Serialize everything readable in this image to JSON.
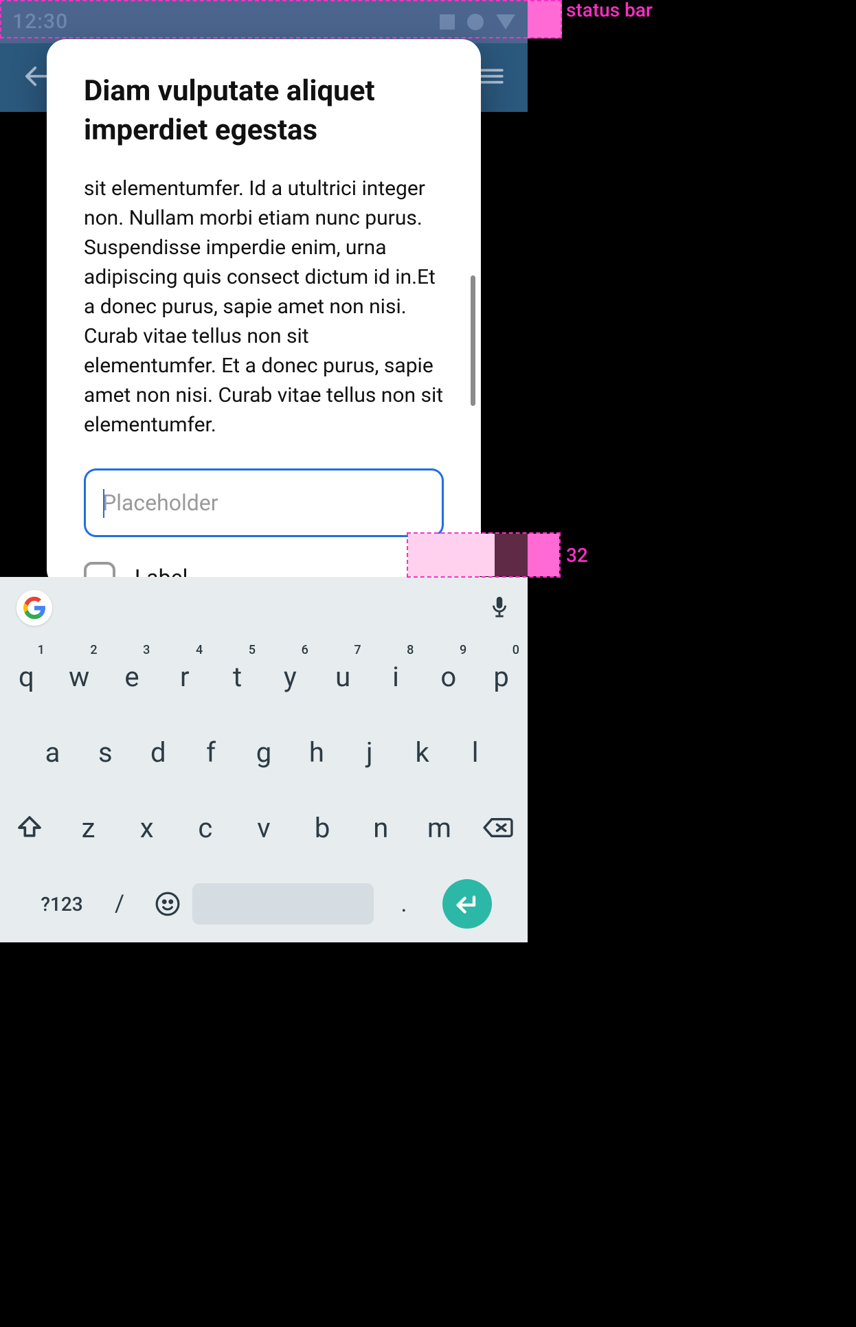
{
  "status": {
    "time": "12:30",
    "label": "status bar"
  },
  "dialog": {
    "title": "Diam vulputate aliquet imperdiet egestas",
    "body": "sit elementumfer. Id a utultrici integer non. Nullam morbi etiam nunc purus. Suspendisse imperdie enim, urna adipiscing quis consect dictum id in.Et a donec purus, sapie amet non nisi. Curab vitae tellus non sit elementumfer. Et a donec purus, sapie amet non nisi. Curab vitae tellus non sit elementumfer.",
    "placeholder": "Placeholder",
    "checkbox_label": "Label"
  },
  "redlines": {
    "keyboard_offset": "32"
  },
  "keyboard": {
    "mode": "?123",
    "slash": "/",
    "dot": ".",
    "row1": [
      {
        "main": "q",
        "sup": "1"
      },
      {
        "main": "w",
        "sup": "2"
      },
      {
        "main": "e",
        "sup": "3"
      },
      {
        "main": "r",
        "sup": "4"
      },
      {
        "main": "t",
        "sup": "5"
      },
      {
        "main": "y",
        "sup": "6"
      },
      {
        "main": "u",
        "sup": "7"
      },
      {
        "main": "i",
        "sup": "8"
      },
      {
        "main": "o",
        "sup": "9"
      },
      {
        "main": "p",
        "sup": "0"
      }
    ],
    "row2": [
      {
        "main": "a"
      },
      {
        "main": "s"
      },
      {
        "main": "d"
      },
      {
        "main": "f"
      },
      {
        "main": "g"
      },
      {
        "main": "h"
      },
      {
        "main": "j"
      },
      {
        "main": "k"
      },
      {
        "main": "l"
      }
    ],
    "row3": [
      {
        "main": "z"
      },
      {
        "main": "x"
      },
      {
        "main": "c"
      },
      {
        "main": "v"
      },
      {
        "main": "b"
      },
      {
        "main": "n"
      },
      {
        "main": "m"
      }
    ]
  }
}
